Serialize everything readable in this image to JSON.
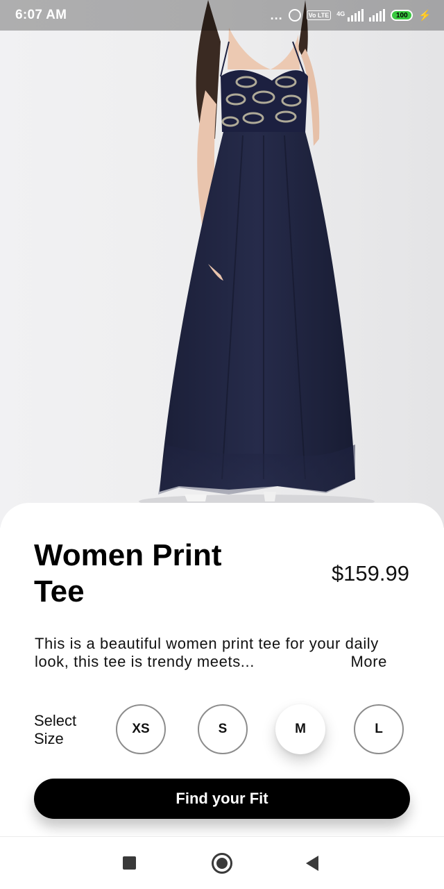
{
  "status_bar": {
    "time": "6:07 AM",
    "more_indicator": "...",
    "volte_label": "Vo LTE",
    "network_type": "4G",
    "battery_level": "100",
    "icons": [
      "alarm-icon",
      "volte-icon",
      "signal-icon",
      "battery-icon",
      "charging-icon"
    ]
  },
  "product": {
    "image_icon": "product-photo",
    "title": "Women Print Tee",
    "price": "$159.99",
    "description": "This is a beautiful women print tee for your daily look, this tee is trendy meets...",
    "more_label": "More"
  },
  "size": {
    "label": "Select Size",
    "options": [
      "XS",
      "S",
      "M",
      "L"
    ],
    "selected": "M"
  },
  "cta": {
    "label": "Find your Fit"
  },
  "nav": {
    "icons": [
      "recents-square-icon",
      "home-circle-icon",
      "back-triangle-icon"
    ]
  },
  "colors": {
    "accent": "#000000",
    "dress": "#1e2340",
    "background": "#ffffff"
  }
}
